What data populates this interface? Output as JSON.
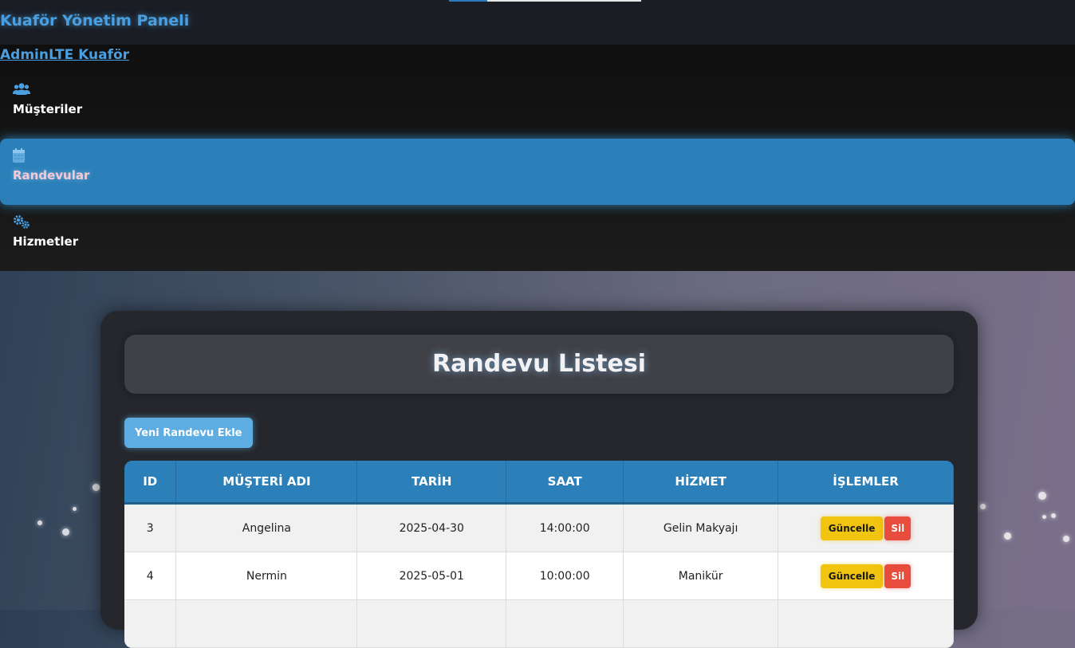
{
  "header": {
    "title": "Kuaför Yönetim Paneli",
    "progress": 0.2
  },
  "sidebar": {
    "brand": "AdminLTE Kuaför",
    "items": [
      {
        "label": "Müşteriler",
        "icon": "users-icon"
      },
      {
        "label": "Randevular",
        "icon": "calendar-icon",
        "active": true
      },
      {
        "label": "Hizmetler",
        "icon": "cogs-icon"
      }
    ]
  },
  "main": {
    "title": "Randevu Listesi",
    "add_button": "Yeni Randevu Ekle",
    "table": {
      "columns": [
        "ID",
        "MÜŞTERİ ADI",
        "TARİH",
        "SAAT",
        "HİZMET",
        "İŞLEMLER"
      ],
      "rows": [
        {
          "id": "3",
          "customer": "Angelina",
          "date": "2025-04-30",
          "time": "14:00:00",
          "service": "Gelin Makyajı"
        },
        {
          "id": "4",
          "customer": "Nermin",
          "date": "2025-05-01",
          "time": "10:00:00",
          "service": "Manikür"
        }
      ],
      "actions": {
        "update": "Güncelle",
        "delete": "Sil"
      }
    }
  },
  "colors": {
    "accent": "#2b80ba",
    "update": "#f1c40f",
    "delete": "#e74c3c",
    "add": "#5dade2"
  }
}
